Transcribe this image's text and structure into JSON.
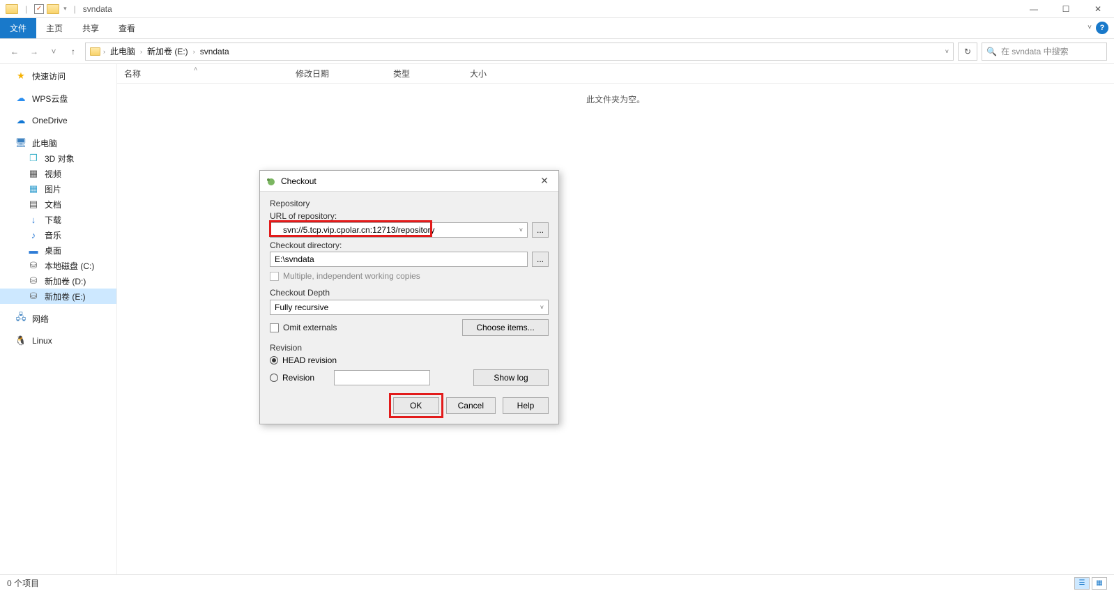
{
  "window": {
    "title": "svndata"
  },
  "ribbon": {
    "tabs": {
      "file": "文件",
      "home": "主页",
      "share": "共享",
      "view": "查看"
    }
  },
  "nav": {
    "back": "←",
    "forward": "→",
    "recent": "˅",
    "up": "↑"
  },
  "breadcrumbs": {
    "b0": "此电脑",
    "b1": "新加卷 (E:)",
    "b2": "svndata"
  },
  "search": {
    "placeholder": "在 svndata 中搜索"
  },
  "columns": {
    "name": "名称",
    "date": "修改日期",
    "type": "类型",
    "size": "大小"
  },
  "empty": "此文件夹为空。",
  "sidebar": {
    "quick": "快速访问",
    "wps": "WPS云盘",
    "onedrive": "OneDrive",
    "pc": "此电脑",
    "obj3d": "3D 对象",
    "video": "视频",
    "pictures": "图片",
    "docs": "文档",
    "downloads": "下载",
    "music": "音乐",
    "desktop": "桌面",
    "diskC": "本地磁盘 (C:)",
    "diskD": "新加卷 (D:)",
    "diskE": "新加卷 (E:)",
    "network": "网络",
    "linux": "Linux"
  },
  "status": {
    "items": "0 个项目"
  },
  "dialog": {
    "title": "Checkout",
    "repository_group": "Repository",
    "url_label": "URL of repository:",
    "url_value": "svn://5.tcp.vip.cpolar.cn:12713/repository",
    "dir_label": "Checkout directory:",
    "dir_value": "E:\\svndata",
    "multi_label": "Multiple, independent working copies",
    "depth_group": "Checkout Depth",
    "depth_value": "Fully recursive",
    "omit_label": "Omit externals",
    "choose_items": "Choose items...",
    "revision_group": "Revision",
    "head_label": "HEAD revision",
    "rev_label": "Revision",
    "show_log": "Show log",
    "ok": "OK",
    "cancel": "Cancel",
    "help": "Help",
    "browse": "..."
  }
}
